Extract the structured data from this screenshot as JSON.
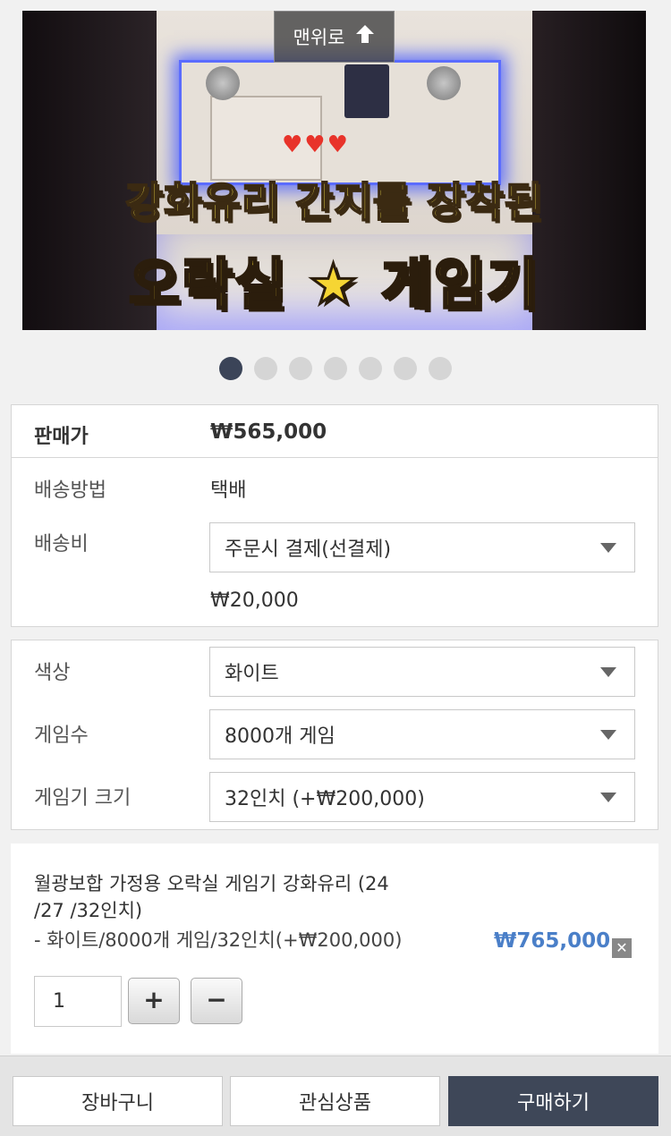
{
  "hero": {
    "caption_line1": "강화유리 간지를 장착된",
    "caption_line2": "오락실 ★ 게임기",
    "hearts": "♥♥♥"
  },
  "top_button": {
    "label": "맨위로",
    "icon": "arrow-up-icon"
  },
  "carousel": {
    "total": 7,
    "active": 1
  },
  "price": {
    "label": "판매가",
    "value": "₩565,000"
  },
  "shipping": {
    "method_label": "배송방법",
    "method_value": "택배",
    "fee_label": "배송비",
    "fee_select": "주문시 결제(선결제)",
    "fee_amount": "₩20,000"
  },
  "options": [
    {
      "label": "색상",
      "selected": "화이트"
    },
    {
      "label": "게임수",
      "selected": "8000개 게임"
    },
    {
      "label": "게임기 크기",
      "selected": "32인치 (+₩200,000)"
    }
  ],
  "summary": {
    "title": "월광보합 가정용 오락실 게임기 강화유리 (24 /27 /32인치)",
    "options": "- 화이트/8000개 게임/32인치(+₩200,000)",
    "total": "₩765,000",
    "remove": "✕",
    "quantity": "1",
    "plus": "+",
    "minus": "−"
  },
  "actions": {
    "cart": "장바구니",
    "wishlist": "관심상품",
    "buy": "구매하기"
  },
  "colors": {
    "buy_button": "#3e4758",
    "total_price": "#4a7fc8",
    "active_dot": "#3b4458"
  }
}
